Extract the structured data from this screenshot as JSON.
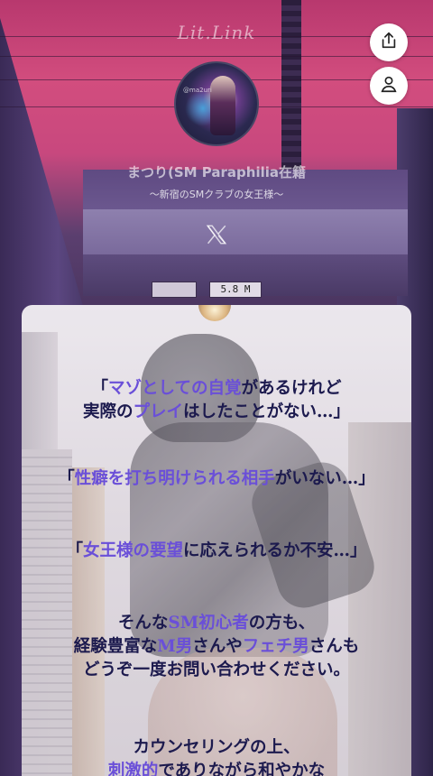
{
  "header": {
    "logo_text": "Lit.Link",
    "share_icon": "share-icon",
    "profile_icon": "user-icon"
  },
  "profile": {
    "avatar_watermark": "@ma2uri",
    "name": "まつり(SM Paraphilia在籍",
    "tagline": "〜新宿のSMクラブの女王様〜",
    "social_icon": "x-icon"
  },
  "background": {
    "sign_text": "5.8 M"
  },
  "card": {
    "line1": {
      "pre": "「",
      "hl1": "マゾとしての自覚",
      "mid": "があるけれど"
    },
    "line2": {
      "pre": "実際の",
      "hl1": "プレイ",
      "post": "はしたことがない…」"
    },
    "line3": {
      "pre": "「",
      "hl1": "性癖を打ち明けられる相手",
      "post": "がいない…」"
    },
    "line4": {
      "pre": "「",
      "hl1": "女王様の要望",
      "post": "に応えられるか不安…」"
    },
    "line5": {
      "pre": "そんな",
      "hl1": "SM初心者",
      "post": "の方も、"
    },
    "line6": {
      "pre": "経験豊富な",
      "hl1": "M男",
      "mid": "さんや",
      "hl2": "フェチ男",
      "post": "さんも"
    },
    "line7": "どうぞ一度お問い合わせください。",
    "line8": "カウンセリングの上、",
    "line9": {
      "hl1": "刺激的",
      "post": "でありながら和やかな"
    }
  },
  "colors": {
    "accent": "#6a4fd8",
    "text_dark": "#1c1a4e",
    "sky": "#d24d7e"
  }
}
